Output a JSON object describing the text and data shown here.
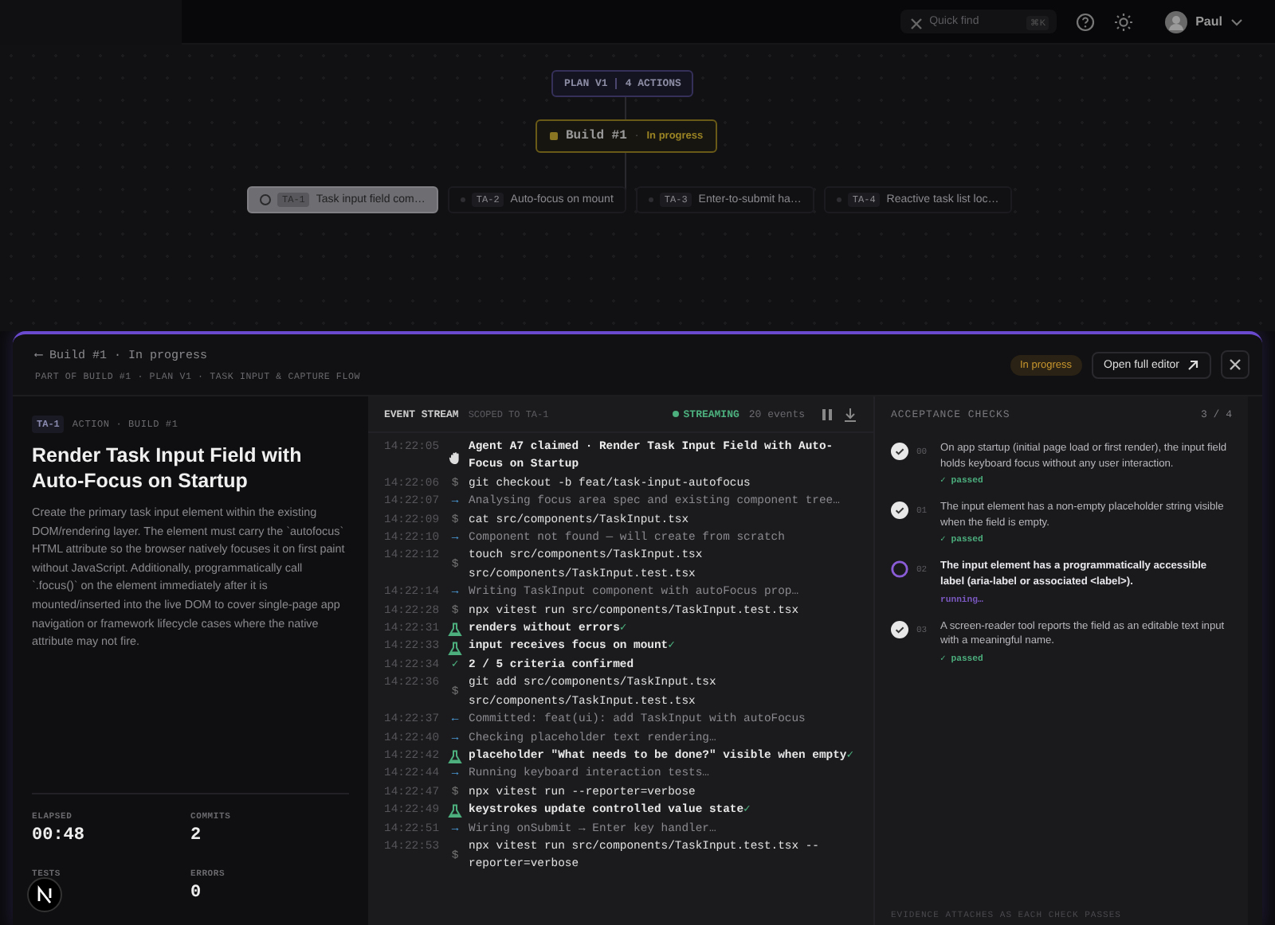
{
  "topbar": {
    "search": {
      "placeholder": "Quick find",
      "shortcut": "⌘K"
    },
    "user": {
      "name": "Paul"
    }
  },
  "canvas": {
    "plan": {
      "label": "PLAN V1",
      "count": "4 ACTIONS"
    },
    "build": {
      "title": "Build #1",
      "separator": "·",
      "status": "In progress"
    },
    "actions": [
      {
        "id": "TA-1",
        "title": "Task input field com…",
        "selected": true
      },
      {
        "id": "TA-2",
        "title": "Auto-focus on mount",
        "selected": false
      },
      {
        "id": "TA-3",
        "title": "Enter-to-submit ha…",
        "selected": false
      },
      {
        "id": "TA-4",
        "title": "Reactive task list loc…",
        "selected": false
      }
    ]
  },
  "panel": {
    "back": "⟵ Build #1 · In progress",
    "path": "PART OF BUILD #1 · PLAN V1 · TASK INPUT & CAPTURE FLOW",
    "status": "In progress",
    "open_button": "Open full editor",
    "task": {
      "id": "TA-1",
      "meta": "ACTION · BUILD #1",
      "title": "Render Task Input Field with Auto-Focus on Startup",
      "description": "Create the primary task input element within the existing DOM/rendering layer. The element must carry the `autofocus` HTML attribute so the browser natively focuses it on first paint without JavaScript. Additionally, programmatically call `.focus()` on the element immediately after it is mounted/inserted into the live DOM to cover single-page app navigation or framework lifecycle cases where the native attribute may not fire.",
      "stats": [
        {
          "label": "ELAPSED",
          "value": "00:48"
        },
        {
          "label": "COMMITS",
          "value": "2"
        },
        {
          "label": "TESTS"
        },
        {
          "label": "ERRORS",
          "value": "0"
        }
      ]
    },
    "stream": {
      "title": "EVENT STREAM",
      "scope": "SCOPED TO TA-1",
      "status": "STREAMING",
      "count": "20 events",
      "events": [
        {
          "time": "14:22:05",
          "kind": "agent",
          "text": "Agent A7 claimed · Render Task Input Field with Auto-Focus on Startup"
        },
        {
          "time": "14:22:06",
          "kind": "cmd",
          "prefix": "$",
          "text": "git checkout -b feat/task-input-autofocus"
        },
        {
          "time": "14:22:07",
          "kind": "info",
          "prefix": "→",
          "text": "Analysing focus area spec and existing component tree…"
        },
        {
          "time": "14:22:09",
          "kind": "cmd",
          "prefix": "$",
          "text": "cat src/components/TaskInput.tsx"
        },
        {
          "time": "14:22:10",
          "kind": "info",
          "prefix": "→",
          "text": "Component not found — will create from scratch"
        },
        {
          "time": "14:22:12",
          "kind": "cmd",
          "prefix": "$",
          "text": "touch src/components/TaskInput.tsx src/components/TaskInput.test.tsx"
        },
        {
          "time": "14:22:14",
          "kind": "info",
          "prefix": "→",
          "text": "Writing TaskInput component with autoFocus prop…"
        },
        {
          "time": "14:22:28",
          "kind": "cmd",
          "prefix": "$",
          "text": "npx vitest run src/components/TaskInput.test.tsx"
        },
        {
          "time": "14:22:31",
          "kind": "test",
          "text": "renders without errors",
          "mark": "✓"
        },
        {
          "time": "14:22:33",
          "kind": "test",
          "text": "input receives focus on mount",
          "mark": "✓"
        },
        {
          "time": "14:22:34",
          "kind": "check",
          "prefix": "✓",
          "text": "2 / 5 criteria confirmed"
        },
        {
          "time": "14:22:36",
          "kind": "cmd",
          "prefix": "$",
          "text": "git add src/components/TaskInput.tsx src/components/TaskInput.test.tsx"
        },
        {
          "time": "14:22:37",
          "kind": "commit",
          "prefix": "←",
          "text": "Committed: feat(ui): add TaskInput with autoFocus"
        },
        {
          "time": "14:22:40",
          "kind": "info",
          "prefix": "→",
          "text": "Checking placeholder text rendering…"
        },
        {
          "time": "14:22:42",
          "kind": "test",
          "text": "placeholder \"What needs to be done?\" visible when empty",
          "mark": "✓"
        },
        {
          "time": "14:22:44",
          "kind": "info",
          "prefix": "→",
          "text": "Running keyboard interaction tests…"
        },
        {
          "time": "14:22:47",
          "kind": "cmd",
          "prefix": "$",
          "text": "npx vitest run --reporter=verbose"
        },
        {
          "time": "14:22:49",
          "kind": "test",
          "text": "keystrokes update controlled value state",
          "mark": "✓"
        },
        {
          "time": "14:22:51",
          "kind": "info",
          "prefix": "→",
          "text": "Wiring onSubmit → Enter key handler…"
        },
        {
          "time": "14:22:53",
          "kind": "cmd",
          "prefix": "$",
          "text": "npx vitest run src/components/TaskInput.test.tsx --reporter=verbose"
        }
      ]
    },
    "checks": {
      "title": "ACCEPTANCE CHECKS",
      "progress": "3 / 4",
      "footer": "EVIDENCE ATTACHES AS EACH CHECK PASSES",
      "items": [
        {
          "number": "00",
          "status": "passed",
          "status_prefix": "✓",
          "text": "On app startup (initial page load or first render), the input field holds keyboard focus without any user interaction."
        },
        {
          "number": "01",
          "status": "passed",
          "status_prefix": "✓",
          "text": "The input element has a non-empty placeholder string visible when the field is empty."
        },
        {
          "number": "02",
          "status": "running",
          "status_suffix": "…",
          "text": "The input element has a programmatically accessible label (aria-label or associated <label>)."
        },
        {
          "number": "03",
          "status": "passed",
          "status_prefix": "✓",
          "text": "A screen-reader tool reports the field as an editable text input with a meaningful name."
        }
      ]
    }
  }
}
